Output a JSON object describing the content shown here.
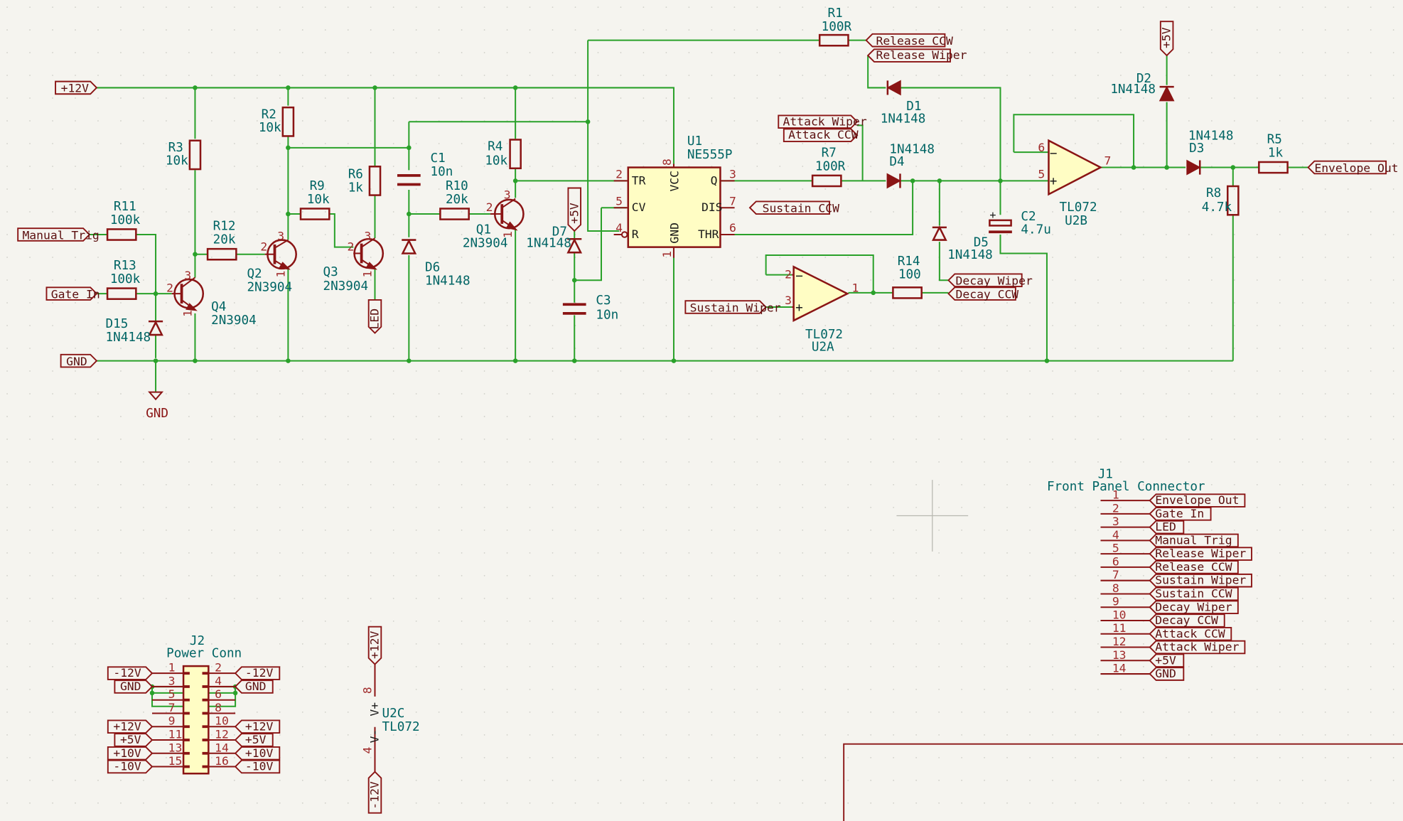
{
  "schematic": {
    "power_rails": {
      "p12v": "+12V",
      "gnd": "GND",
      "gnd_symbol": "GND",
      "p5v": "+5V",
      "m12v": "-12V"
    },
    "hier_ports": {
      "manual_trig": "Manual Trig",
      "gate_in": "Gate In",
      "release_ccw": "Release CCW",
      "release_wiper": "Release Wiper",
      "attack_wiper": "Attack Wiper",
      "attack_ccw": "Attack CCW",
      "sustain_ccw": "Sustain CCW",
      "sustain_wiper": "Sustain Wiper",
      "decay_wiper": "Decay Wiper",
      "decay_ccw": "Decay CCW",
      "envelope_out": "Envelope Out",
      "led": "LED"
    },
    "components": {
      "r1": {
        "ref": "R1",
        "value": "100R"
      },
      "r2": {
        "ref": "R2",
        "value": "10k"
      },
      "r3": {
        "ref": "R3",
        "value": "10k"
      },
      "r4": {
        "ref": "R4",
        "value": "10k"
      },
      "r5": {
        "ref": "R5",
        "value": "1k"
      },
      "r6": {
        "ref": "R6",
        "value": "1k"
      },
      "r7": {
        "ref": "R7",
        "value": "100R"
      },
      "r8": {
        "ref": "R8",
        "value": "4.7k"
      },
      "r9": {
        "ref": "R9",
        "value": "10k"
      },
      "r10": {
        "ref": "R10",
        "value": "20k"
      },
      "r11": {
        "ref": "R11",
        "value": "100k"
      },
      "r12": {
        "ref": "R12",
        "value": "20k"
      },
      "r13": {
        "ref": "R13",
        "value": "100k"
      },
      "r14": {
        "ref": "R14",
        "value": "100"
      },
      "c1": {
        "ref": "C1",
        "value": "10n"
      },
      "c2": {
        "ref": "C2",
        "value": "4.7u"
      },
      "c3": {
        "ref": "C3",
        "value": "10n"
      },
      "q1": {
        "ref": "Q1",
        "value": "2N3904"
      },
      "q2": {
        "ref": "Q2",
        "value": "2N3904"
      },
      "q3": {
        "ref": "Q3",
        "value": "2N3904"
      },
      "q4": {
        "ref": "Q4",
        "value": "2N3904"
      },
      "d1": {
        "ref": "D1",
        "value": "1N4148"
      },
      "d2": {
        "ref": "D2",
        "value": "1N4148"
      },
      "d3": {
        "ref": "D3",
        "value": "1N4148"
      },
      "d4": {
        "ref": "D4",
        "value": "1N4148"
      },
      "d5": {
        "ref": "D5",
        "value": "1N4148"
      },
      "d6": {
        "ref": "D6",
        "value": "1N4148"
      },
      "d7": {
        "ref": "D7",
        "value": "1N4148"
      },
      "d15": {
        "ref": "D15",
        "value": "1N4148"
      },
      "u1": {
        "ref": "U1",
        "value": "NE555P",
        "pins": {
          "tr": "TR",
          "cv": "CV",
          "r": "R",
          "vcc": "VCC",
          "q": "Q",
          "dis": "DIS",
          "thr": "THR",
          "gnd": "GND"
        }
      },
      "u2a": {
        "ref": "U2A",
        "value": "TL072"
      },
      "u2b": {
        "ref": "U2B",
        "value": "TL072"
      },
      "u2c": {
        "ref": "U2C",
        "value": "TL072",
        "vplus": "V+",
        "vminus": "V-"
      }
    },
    "j1": {
      "ref": "J1",
      "value": "Front Panel Connector",
      "pins": [
        {
          "num": "1",
          "label": "Envelope Out"
        },
        {
          "num": "2",
          "label": "Gate In"
        },
        {
          "num": "3",
          "label": "LED"
        },
        {
          "num": "4",
          "label": "Manual Trig"
        },
        {
          "num": "5",
          "label": "Release Wiper"
        },
        {
          "num": "6",
          "label": "Release CCW"
        },
        {
          "num": "7",
          "label": "Sustain Wiper"
        },
        {
          "num": "8",
          "label": "Sustain CCW"
        },
        {
          "num": "9",
          "label": "Decay Wiper"
        },
        {
          "num": "10",
          "label": "Decay CCW"
        },
        {
          "num": "11",
          "label": "Attack CCW"
        },
        {
          "num": "12",
          "label": "Attack Wiper"
        },
        {
          "num": "13",
          "label": "+5V"
        },
        {
          "num": "14",
          "label": "GND"
        }
      ]
    },
    "j2": {
      "ref": "J2",
      "value": "Power Conn",
      "rows": [
        {
          "lnum": "1",
          "rnum": "2",
          "llabel": "-12V",
          "rlabel": "-12V"
        },
        {
          "lnum": "3",
          "rnum": "4",
          "llabel": "GND",
          "rlabel": "GND"
        },
        {
          "lnum": "5",
          "rnum": "6",
          "llabel": "",
          "rlabel": ""
        },
        {
          "lnum": "7",
          "rnum": "8",
          "llabel": "",
          "rlabel": ""
        },
        {
          "lnum": "9",
          "rnum": "10",
          "llabel": "+12V",
          "rlabel": "+12V"
        },
        {
          "lnum": "11",
          "rnum": "12",
          "llabel": "+5V",
          "rlabel": "+5V"
        },
        {
          "lnum": "13",
          "rnum": "14",
          "llabel": "+10V",
          "rlabel": "+10V"
        },
        {
          "lnum": "15",
          "rnum": "16",
          "llabel": "-10V",
          "rlabel": "-10V"
        }
      ]
    },
    "pin_numbers": {
      "n1": "1",
      "n2": "2",
      "n3": "3",
      "n4": "4",
      "n5": "5",
      "n6": "6",
      "n7": "7",
      "n8": "8"
    }
  }
}
